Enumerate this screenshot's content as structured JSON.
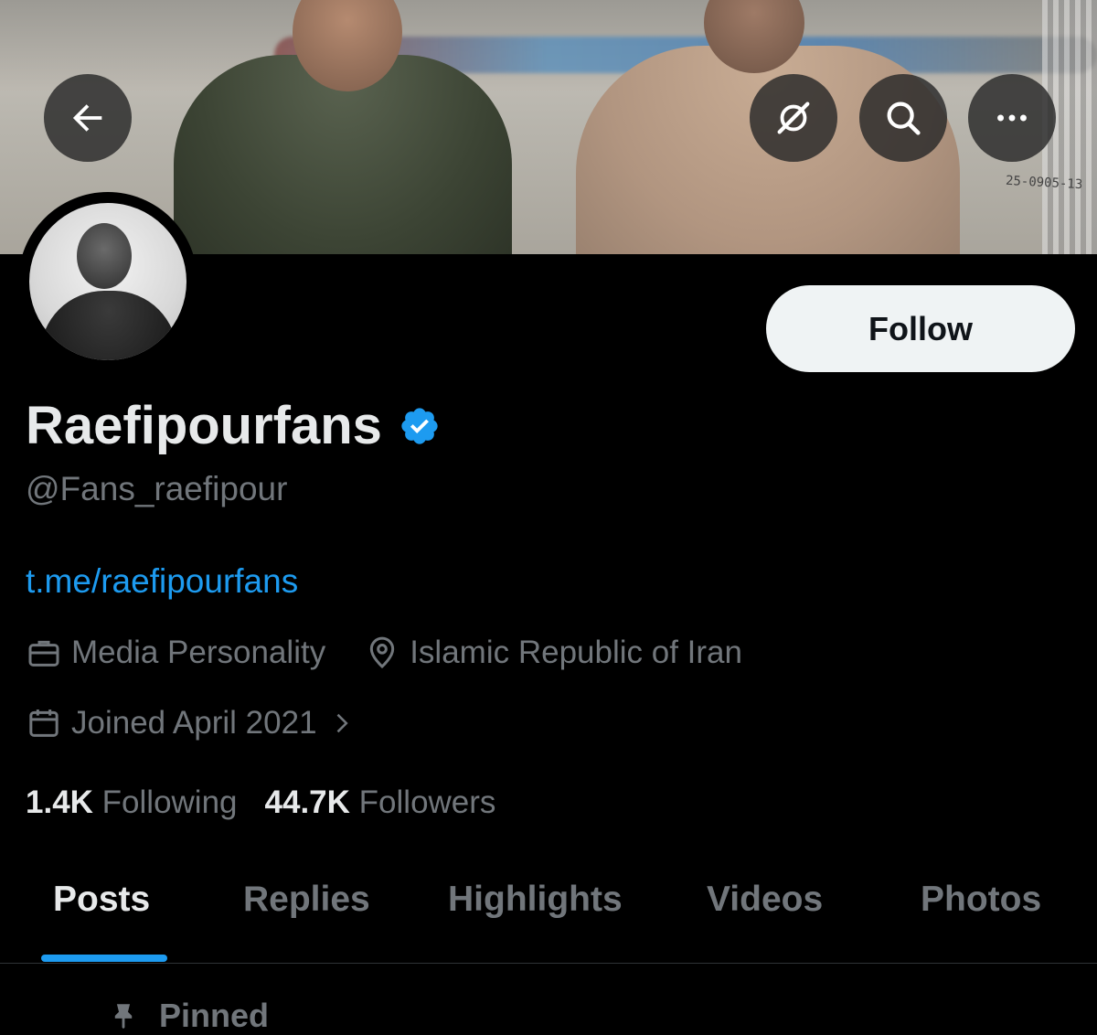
{
  "banner": {
    "serial_text": "25-0905-13"
  },
  "icons": {
    "back": "arrow-left-icon",
    "grok": "grok-icon",
    "search": "search-icon",
    "more": "more-icon",
    "verified": "verified-badge-icon",
    "profession": "briefcase-icon",
    "location": "location-pin-icon",
    "joined": "calendar-icon",
    "pinned": "pin-icon"
  },
  "colors": {
    "accent": "#1d9bf0",
    "muted": "#71767b",
    "text": "#e7e9ea",
    "background": "#000000"
  },
  "profile": {
    "display_name": "Raefipourfans",
    "handle": "@Fans_raefipour",
    "link": "t.me/raefipourfans",
    "profession": "Media Personality",
    "location": "Islamic Republic of Iran",
    "joined": "Joined April 2021",
    "following_count": "1.4K",
    "following_label": "Following",
    "followers_count": "44.7K",
    "followers_label": "Followers"
  },
  "actions": {
    "follow_label": "Follow"
  },
  "tabs": [
    {
      "label": "Posts",
      "active": true
    },
    {
      "label": "Replies",
      "active": false
    },
    {
      "label": "Highlights",
      "active": false
    },
    {
      "label": "Videos",
      "active": false
    },
    {
      "label": "Photos",
      "active": false
    }
  ],
  "feed": {
    "pinned_label": "Pinned"
  }
}
